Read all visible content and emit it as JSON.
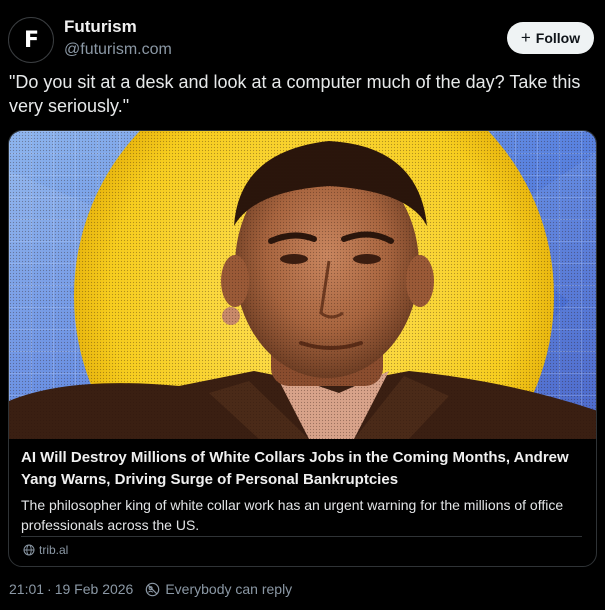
{
  "author": {
    "avatar_letter": "F",
    "display_name": "Futurism",
    "handle": "@futurism.com"
  },
  "follow_button": {
    "icon": "plus-icon",
    "label": "Follow"
  },
  "post": {
    "text": "\"Do you sit at a desk and look at a computer much of the day? Take this very seriously.\""
  },
  "link_card": {
    "image_icon": "article-photo",
    "title": "AI Will Destroy Millions of White Collars Jobs in the Coming Months, Andrew Yang Warns, Driving Surge of Personal Bankruptcies",
    "description": "The philosopher king of white collar work has an urgent warning for the millions of office professionals across the US.",
    "source_icon": "globe-icon",
    "source": "trib.al"
  },
  "meta": {
    "time": "21:01",
    "separator": "·",
    "date": "19 Feb 2026",
    "reply_icon": "reply-restriction-icon",
    "reply_setting": "Everybody can reply"
  },
  "colors": {
    "background": "#000000",
    "follow_bg": "#eff3f4",
    "muted_text": "#8b98a5",
    "border": "#2f3336"
  }
}
